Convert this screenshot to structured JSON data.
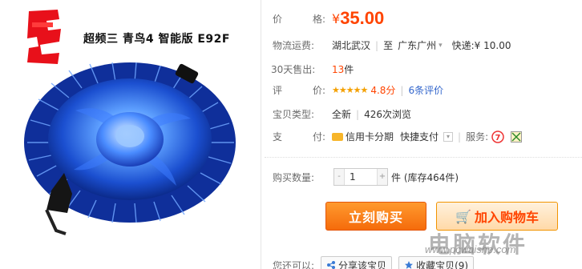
{
  "product": {
    "title": "超频三 青鸟4 智能版 E92F"
  },
  "price": {
    "label_chars": [
      "价",
      "格:"
    ],
    "symbol": "¥",
    "value": "35.00"
  },
  "shipping": {
    "label": "物流运费:",
    "from": "湖北武汉",
    "to_word": "至",
    "to": "广东广州",
    "express": "快递:¥ 10.00"
  },
  "sold": {
    "label": "30天售出:",
    "count": "13",
    "unit": "件"
  },
  "rating": {
    "label_chars": [
      "评",
      "价:"
    ],
    "stars": "★★★★★",
    "score": "4.8分",
    "reviews": "6条评价"
  },
  "type": {
    "label": "宝贝类型:",
    "condition": "全新",
    "views": "426次浏览"
  },
  "payment": {
    "label_chars": [
      "支",
      "付:"
    ],
    "credit": "信用卡分期",
    "quick": "快捷支付",
    "service_label": "服务:"
  },
  "quantity": {
    "label": "购买数量:",
    "value": "1",
    "minus": "-",
    "plus": "+",
    "stock": "件 (库存464件)"
  },
  "actions": {
    "buy": "立刻购买",
    "cart": "加入购物车"
  },
  "share": {
    "label": "您还可以:",
    "share_btn": "分享该宝贝",
    "fav_btn": "收藏宝贝(9)"
  },
  "watermark": {
    "brand": "电脑软件",
    "url": "www.pcwaishe.com"
  },
  "colors": {
    "price": "#ff4400",
    "accent_orange": "#f56b0b",
    "fan_blue": "#1f4fd6"
  }
}
